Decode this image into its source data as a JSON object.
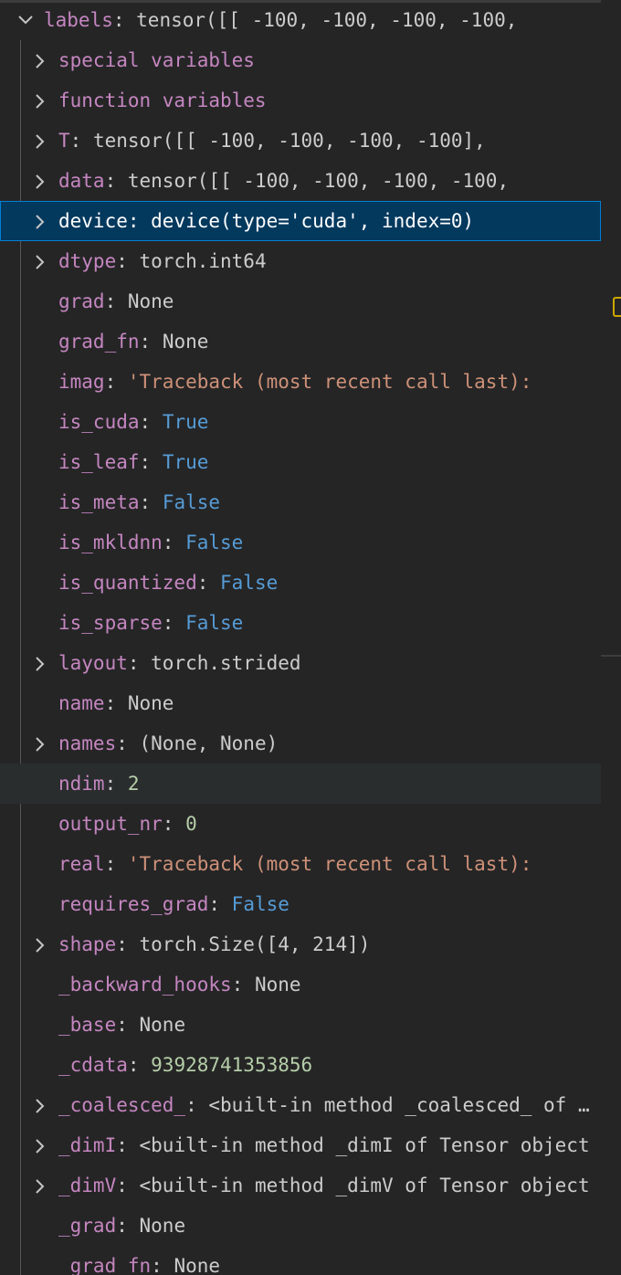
{
  "variables": {
    "root": {
      "name": "labels",
      "value": "tensor([[ -100,  -100,  -100,  -100,",
      "expanded": true
    },
    "children": [
      {
        "name": "special variables",
        "value": "",
        "type": "group",
        "expandable": true
      },
      {
        "name": "function variables",
        "value": "",
        "type": "group",
        "expandable": true
      },
      {
        "name": "T",
        "value": "tensor([[ -100,  -100,  -100,  -100],",
        "type": "obj",
        "expandable": true
      },
      {
        "name": "data",
        "value": "tensor([[ -100,  -100,  -100,  -100,",
        "type": "obj",
        "expandable": true
      },
      {
        "name": "device",
        "value": "device(type='cuda', index=0)",
        "type": "obj",
        "expandable": true,
        "selected": true
      },
      {
        "name": "dtype",
        "value": "torch.int64",
        "type": "obj",
        "expandable": true
      },
      {
        "name": "grad",
        "value": "None",
        "type": "obj",
        "expandable": false
      },
      {
        "name": "grad_fn",
        "value": "None",
        "type": "obj",
        "expandable": false
      },
      {
        "name": "imag",
        "value": "'Traceback (most recent call last):",
        "type": "string",
        "expandable": false
      },
      {
        "name": "is_cuda",
        "value": "True",
        "type": "bool",
        "expandable": false
      },
      {
        "name": "is_leaf",
        "value": "True",
        "type": "bool",
        "expandable": false
      },
      {
        "name": "is_meta",
        "value": "False",
        "type": "bool",
        "expandable": false
      },
      {
        "name": "is_mkldnn",
        "value": "False",
        "type": "bool",
        "expandable": false
      },
      {
        "name": "is_quantized",
        "value": "False",
        "type": "bool",
        "expandable": false
      },
      {
        "name": "is_sparse",
        "value": "False",
        "type": "bool",
        "expandable": false
      },
      {
        "name": "layout",
        "value": "torch.strided",
        "type": "obj",
        "expandable": true
      },
      {
        "name": "name",
        "value": "None",
        "type": "obj",
        "expandable": false
      },
      {
        "name": "names",
        "value": "(None, None)",
        "type": "obj",
        "expandable": true
      },
      {
        "name": "ndim",
        "value": "2",
        "type": "number",
        "expandable": false,
        "hovered": true
      },
      {
        "name": "output_nr",
        "value": "0",
        "type": "number",
        "expandable": false
      },
      {
        "name": "real",
        "value": "'Traceback (most recent call last):",
        "type": "string",
        "expandable": false
      },
      {
        "name": "requires_grad",
        "value": "False",
        "type": "bool",
        "expandable": false
      },
      {
        "name": "shape",
        "value": "torch.Size([4, 214])",
        "type": "obj",
        "expandable": true
      },
      {
        "name": "_backward_hooks",
        "value": "None",
        "type": "obj",
        "expandable": false
      },
      {
        "name": "_base",
        "value": "None",
        "type": "obj",
        "expandable": false
      },
      {
        "name": "_cdata",
        "value": "93928741353856",
        "type": "number",
        "expandable": false
      },
      {
        "name": "_coalesced_",
        "value": "<built-in method _coalesced_ of Tensor object",
        "type": "obj",
        "expandable": true
      },
      {
        "name": "_dimI",
        "value": "<built-in method _dimI of Tensor object",
        "type": "obj",
        "expandable": true
      },
      {
        "name": "_dimV",
        "value": "<built-in method _dimV of Tensor object",
        "type": "obj",
        "expandable": true
      },
      {
        "name": "_grad",
        "value": "None",
        "type": "obj",
        "expandable": false
      },
      {
        "name": "_grad_fn",
        "value": "None",
        "type": "obj",
        "expandable": false
      }
    ]
  },
  "colors": {
    "background": "#252526",
    "selection": "#04395e",
    "selection_border": "#007fd4",
    "name": "#c586c0",
    "string": "#ce9178",
    "boolean": "#569cd6",
    "number": "#b5cea8",
    "warning": "#cca700"
  },
  "icons": {
    "expanded": "chevron-down-icon",
    "collapsed": "chevron-right-icon"
  }
}
